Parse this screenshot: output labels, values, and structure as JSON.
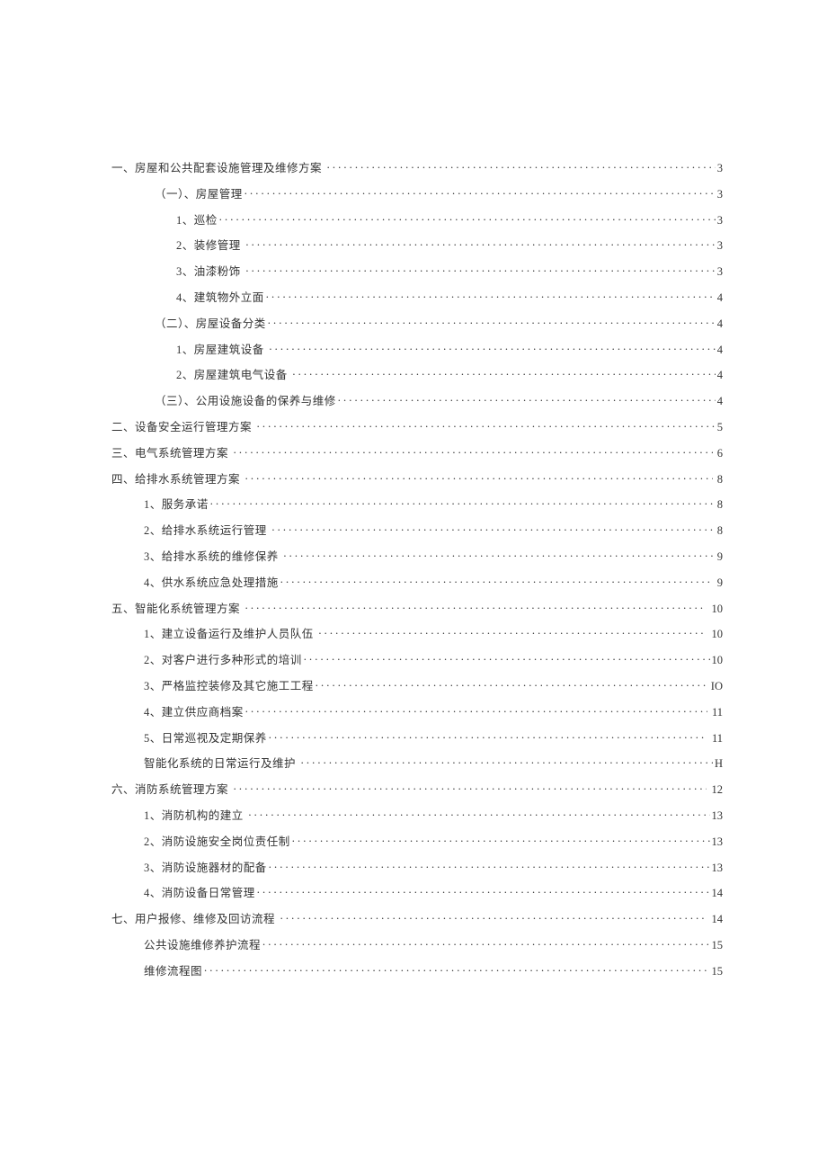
{
  "toc": [
    {
      "label": "一、房屋和公共配套设施管理及维修方案 ",
      "page": "3",
      "level": "lvl-0"
    },
    {
      "label": "（一）、房屋管理",
      "page": "3",
      "level": "lvl-1"
    },
    {
      "label": "1、巡检",
      "page": "3",
      "level": "lvl-2"
    },
    {
      "label": "2、装修管理 ",
      "page": "3",
      "level": "lvl-2"
    },
    {
      "label": "3、油漆粉饰 ",
      "page": "3",
      "level": "lvl-2"
    },
    {
      "label": "4、建筑物外立面",
      "page": "4",
      "level": "lvl-2"
    },
    {
      "label": "（二）、房屋设备分类",
      "page": "4",
      "level": "lvl-1"
    },
    {
      "label": "1、房屋建筑设备 ",
      "page": "4",
      "level": "lvl-2"
    },
    {
      "label": "2、房屋建筑电气设备 ",
      "page": "4",
      "level": "lvl-2"
    },
    {
      "label": "（三）、公用设施设备的保养与维修",
      "page": "4",
      "level": "lvl-1"
    },
    {
      "label": "二、设备安全运行管理方案 ",
      "page": "5",
      "level": "lvl-0"
    },
    {
      "label": "三、电气系统管理方案 ",
      "page": " 6",
      "level": "lvl-0"
    },
    {
      "label": "四、给排水系统管理方案 ",
      "page": " 8",
      "level": "lvl-0"
    },
    {
      "label": "1、服务承诺",
      "page": " 8",
      "level": "lvl-p1"
    },
    {
      "label": "2、给排水系统运行管理 ",
      "page": " 8",
      "level": "lvl-p1"
    },
    {
      "label": "3、给排水系统的维修保养 ",
      "page": " 9",
      "level": "lvl-p1"
    },
    {
      "label": "4、供水系统应急处理措施",
      "page": " 9",
      "level": "lvl-p1"
    },
    {
      "label": "五、智能化系统管理方案 ",
      "page": " 10",
      "level": "lvl-0"
    },
    {
      "label": "1、建立设备运行及维护人员队伍 ",
      "page": " 10",
      "level": "lvl-p1"
    },
    {
      "label": "2、对客户进行多种形式的培训",
      "page": "10",
      "level": "lvl-p1"
    },
    {
      "label": "3、严格监控装修及其它施工工程",
      "page": "IO",
      "level": "lvl-p1"
    },
    {
      "label": "4、建立供应商档案",
      "page": " 11",
      "level": "lvl-p1"
    },
    {
      "label": "5、日常巡视及定期保养",
      "page": " 11",
      "level": "lvl-p1"
    },
    {
      "label": "智能化系统的日常运行及维护 ",
      "page": "H",
      "level": "lvl-p1"
    },
    {
      "label": "六、消防系统管理方案 ",
      "page": " 12",
      "level": "lvl-0"
    },
    {
      "label": "1、消防机构的建立 ",
      "page": "13",
      "level": "lvl-p1"
    },
    {
      "label": "2、消防设施安全岗位责任制",
      "page": "13",
      "level": "lvl-p1"
    },
    {
      "label": "3、消防设施器材的配备",
      "page": "13",
      "level": "lvl-p1"
    },
    {
      "label": "4、消防设备日常管理",
      "page": "14",
      "level": "lvl-p1"
    },
    {
      "label": "七、用户报修、维修及回访流程 ",
      "page": " 14",
      "level": "lvl-0"
    },
    {
      "label": "公共设施维修养护流程",
      "page": "15",
      "level": "lvl-p1"
    },
    {
      "label": "维修流程图",
      "page": "15",
      "level": "lvl-p1"
    }
  ]
}
